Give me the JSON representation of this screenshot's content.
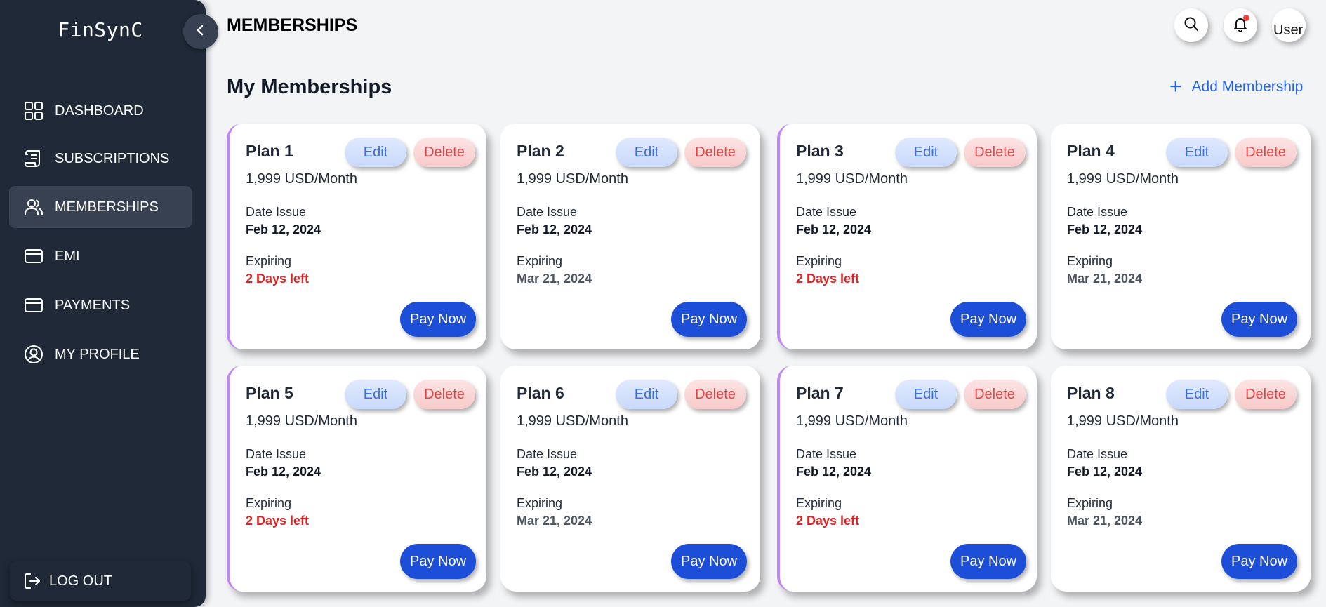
{
  "app": {
    "logo": "FinSynC"
  },
  "sidebar": {
    "items": [
      {
        "label": "DASHBOARD",
        "icon": "grid-icon",
        "active": false
      },
      {
        "label": "SUBSCRIPTIONS",
        "icon": "scroll-icon",
        "active": false
      },
      {
        "label": "MEMBERSHIPS",
        "icon": "users-icon",
        "active": true
      },
      {
        "label": "EMI",
        "icon": "card-icon",
        "active": false
      },
      {
        "label": "PAYMENTS",
        "icon": "card-icon",
        "active": false
      },
      {
        "label": "MY PROFILE",
        "icon": "user-circle-icon",
        "active": false
      }
    ],
    "logout_label": "LOG OUT"
  },
  "header": {
    "title": "MEMBERSHIPS",
    "avatar_alt": "User",
    "notification_dot_color": "#ef4444"
  },
  "main": {
    "section_title": "My Memberships",
    "add_label": "Add Membership",
    "labels": {
      "edit": "Edit",
      "delete": "Delete",
      "date_issue": "Date Issue",
      "expiring": "Expiring",
      "pay": "Pay Now"
    },
    "plans": [
      {
        "name": "Plan 1",
        "price": "1,999 USD/Month",
        "issued": "Feb 12, 2024",
        "expiring": "2 Days left",
        "urgent": true
      },
      {
        "name": "Plan 2",
        "price": "1,999 USD/Month",
        "issued": "Feb 12, 2024",
        "expiring": "Mar 21, 2024",
        "urgent": false
      },
      {
        "name": "Plan 3",
        "price": "1,999 USD/Month",
        "issued": "Feb 12, 2024",
        "expiring": "2 Days left",
        "urgent": true
      },
      {
        "name": "Plan 4",
        "price": "1,999 USD/Month",
        "issued": "Feb 12, 2024",
        "expiring": "Mar 21, 2024",
        "urgent": false
      },
      {
        "name": "Plan 5",
        "price": "1,999 USD/Month",
        "issued": "Feb 12, 2024",
        "expiring": "2 Days left",
        "urgent": true
      },
      {
        "name": "Plan 6",
        "price": "1,999 USD/Month",
        "issued": "Feb 12, 2024",
        "expiring": "Mar 21, 2024",
        "urgent": false
      },
      {
        "name": "Plan 7",
        "price": "1,999 USD/Month",
        "issued": "Feb 12, 2024",
        "expiring": "2 Days left",
        "urgent": true
      },
      {
        "name": "Plan 8",
        "price": "1,999 USD/Month",
        "issued": "Feb 12, 2024",
        "expiring": "Mar 21, 2024",
        "urgent": false
      }
    ]
  },
  "colors": {
    "sidebar_bg": "#1f2937",
    "accent_border": "#c084fc",
    "primary": "#1d4ed8",
    "urgent": "#dc2626"
  }
}
